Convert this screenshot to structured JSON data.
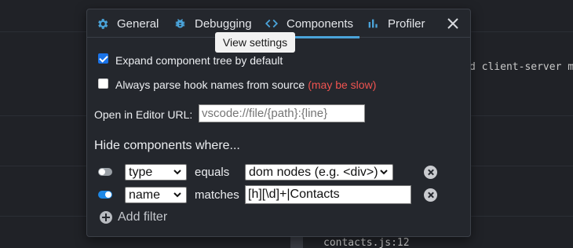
{
  "background": {
    "code_line_1": "d client-server m",
    "code_line_2": "contacts.js:12"
  },
  "tabs": [
    {
      "label": "General",
      "icon": "gear-icon"
    },
    {
      "label": "Debugging",
      "icon": "bug-icon"
    },
    {
      "label": "Components",
      "icon": "code-icon",
      "active": true
    },
    {
      "label": "Profiler",
      "icon": "bar-chart-icon"
    }
  ],
  "tooltip": "View settings",
  "settings": {
    "expand_tree": {
      "label": "Expand component tree by default",
      "checked": true
    },
    "parse_hooks": {
      "label": "Always parse hook names from source",
      "note": "(may be slow)",
      "checked": false
    },
    "editor_url": {
      "label": "Open in Editor URL:",
      "placeholder": "vscode://file/{path}:{line}"
    }
  },
  "hide_heading": "Hide components where...",
  "filters": [
    {
      "enabled": false,
      "field": "type",
      "operator": "equals",
      "value": "dom nodes (e.g. <div>)"
    },
    {
      "enabled": true,
      "field": "name",
      "operator": "matches",
      "value": "[h][\\d]+|Contacts"
    }
  ],
  "add_filter_label": "Add filter",
  "colors": {
    "accent": "#4aa3d9",
    "warning": "#ef5350",
    "panel": "#24272d",
    "toggle_on": "#1e88e5"
  }
}
